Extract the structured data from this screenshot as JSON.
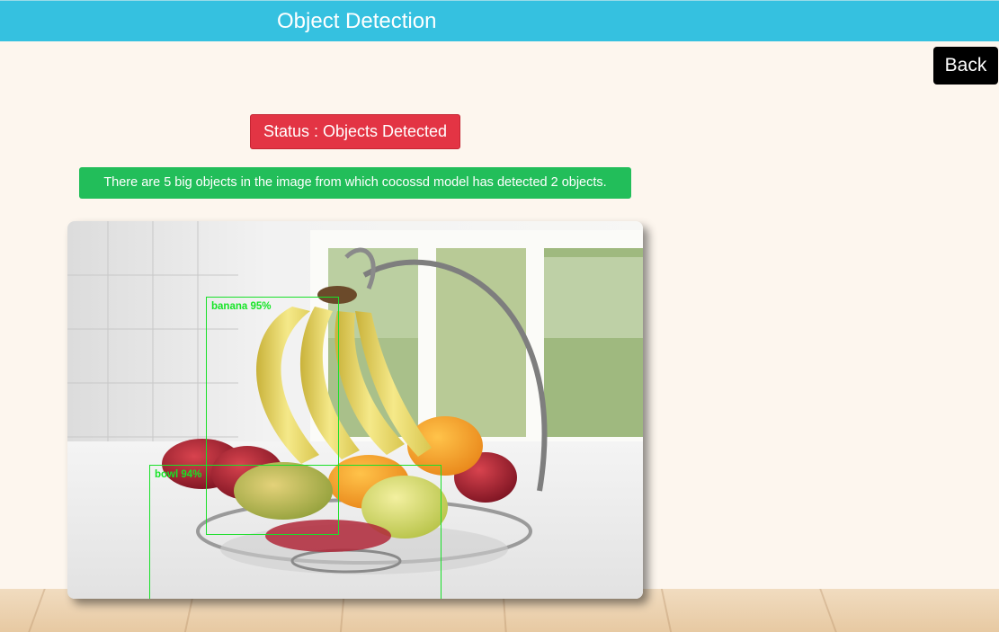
{
  "header": {
    "title": "Object Detection"
  },
  "back_button": {
    "label": "Back"
  },
  "status": {
    "text": "Status : Objects Detected"
  },
  "info": {
    "text": "There are 5 big objects in the image from which cocossd model has detected 2 objects."
  },
  "detections": [
    {
      "label": "banana 95%"
    },
    {
      "label": "bowl 94%"
    }
  ],
  "colors": {
    "header": "#35c1e0",
    "status_badge": "#e33444",
    "info_banner": "#22be5a",
    "detection_box": "#19e02a",
    "page_background": "#fdf6ee"
  }
}
